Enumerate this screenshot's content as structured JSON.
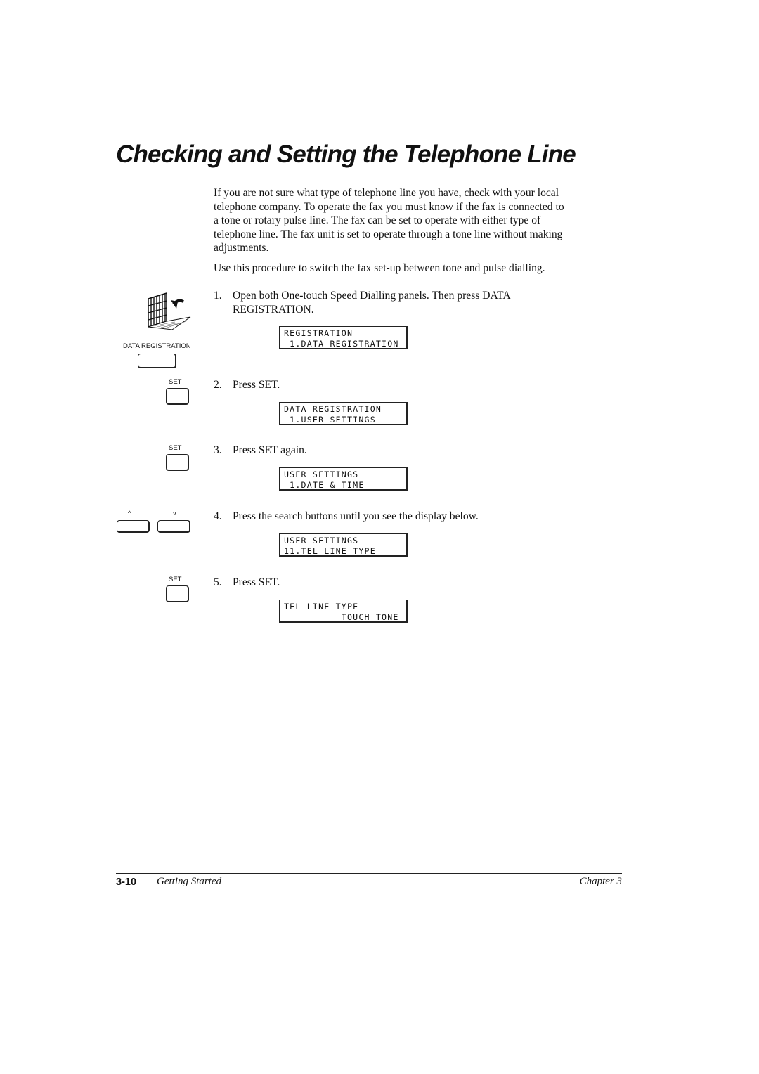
{
  "title": "Checking and Setting the Telephone Line",
  "intro": {
    "lines": [
      "If you are not sure what type of telephone line you have, check with your local",
      "telephone company. To operate the fax you must know if the fax is connected to",
      "a tone or rotary pulse line. The fax can be set to operate with either type of",
      "telephone line. The fax unit is set to operate through a tone line without making",
      "adjustments."
    ],
    "procedure": "Use this procedure to switch the fax set-up between tone and pulse dialling."
  },
  "steps": [
    {
      "num": "1.",
      "lines": [
        "Open both One-touch Speed Dialling panels. Then press DATA",
        "REGISTRATION."
      ],
      "lcd": [
        "REGISTRATION",
        " 1.DATA REGISTRATION"
      ]
    },
    {
      "num": "2.",
      "lines": [
        "Press SET."
      ],
      "lcd": [
        "DATA REGISTRATION",
        " 1.USER SETTINGS"
      ]
    },
    {
      "num": "3.",
      "lines": [
        "Press SET again."
      ],
      "lcd": [
        "USER SETTINGS",
        " 1.DATE & TIME"
      ]
    },
    {
      "num": "4.",
      "lines": [
        "Press the search buttons until you see the display below."
      ],
      "lcd": [
        "USER SETTINGS",
        "11.TEL LINE TYPE"
      ]
    },
    {
      "num": "5.",
      "lines": [
        "Press SET."
      ],
      "lcd": [
        "TEL LINE TYPE",
        "          TOUCH TONE"
      ]
    }
  ],
  "keys": {
    "data_registration": "DATA REGISTRATION",
    "set": "SET",
    "up": "^",
    "down": "v"
  },
  "footer": {
    "page": "3-10",
    "section": "Getting Started",
    "chapter": "Chapter 3"
  }
}
